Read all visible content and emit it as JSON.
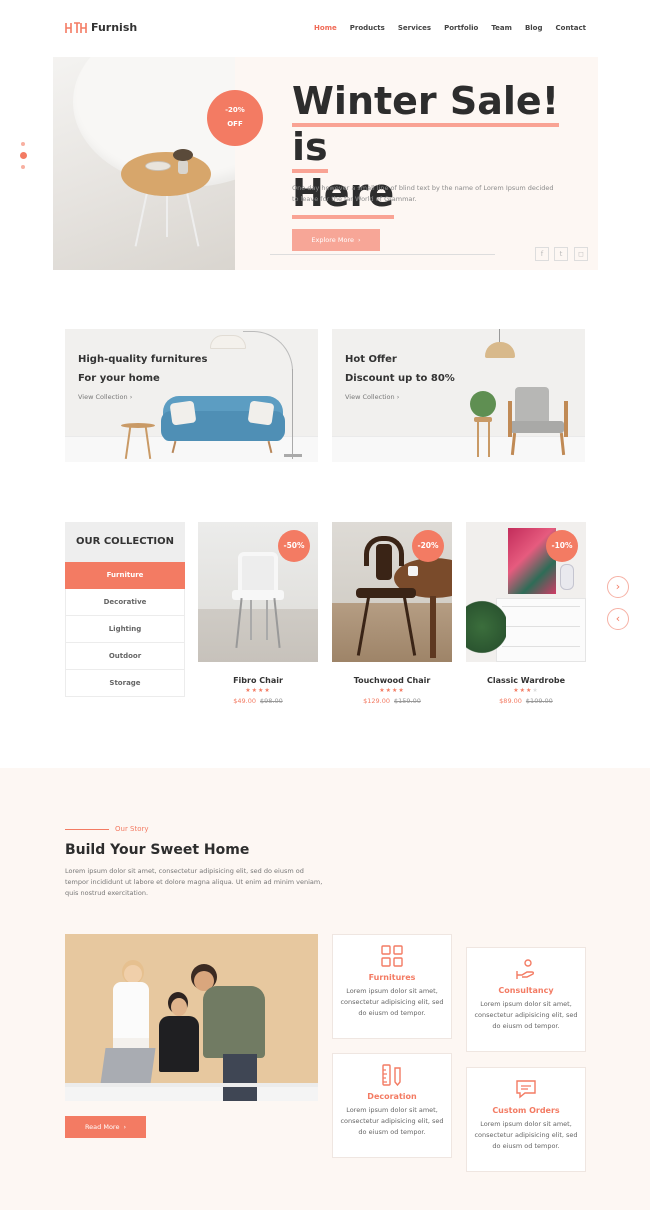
{
  "brand": {
    "logo_mark": "HTH",
    "name": "Furnish"
  },
  "nav": [
    {
      "label": "Home",
      "active": true
    },
    {
      "label": "Products"
    },
    {
      "label": "Services"
    },
    {
      "label": "Portfolio"
    },
    {
      "label": "Team"
    },
    {
      "label": "Blog"
    },
    {
      "label": "Contact"
    }
  ],
  "hero": {
    "badge_line1": "-20%",
    "badge_line2": "OFF",
    "title_line1": "Winter Sale! is",
    "title_line2": "Here",
    "description": "One day however a small line of blind text by the name of Lorem Ipsum decided to leave for the far World of Grammar.",
    "button_label": "Explore More",
    "social_icons": [
      "facebook-icon",
      "twitter-icon",
      "instagram-icon"
    ]
  },
  "promos": [
    {
      "line1": "High-quality furnitures",
      "line2": "For your home",
      "link": "View Collection"
    },
    {
      "line1": "Hot Offer",
      "line2": "Discount up to 80%",
      "link": "View Collection"
    }
  ],
  "collection": {
    "heading": "OUR COLLECTION",
    "categories": [
      {
        "label": "Furniture",
        "active": true
      },
      {
        "label": "Decorative"
      },
      {
        "label": "Lighting"
      },
      {
        "label": "Outdoor"
      },
      {
        "label": "Storage"
      }
    ],
    "products": [
      {
        "name": "Fibro Chair",
        "badge": "-50%",
        "rating": 4,
        "price": "$49.00",
        "old_price": "$98.00"
      },
      {
        "name": "Touchwood Chair",
        "badge": "-20%",
        "rating": 4,
        "price": "$129.00",
        "old_price": "$159.00"
      },
      {
        "name": "Classic Wardrobe",
        "badge": "-10%",
        "rating": 3,
        "price": "$89.00",
        "old_price": "$109.00"
      }
    ]
  },
  "story": {
    "kicker": "Our Story",
    "title": "Build Your Sweet Home",
    "description": "Lorem ipsum dolor sit amet, consectetur adipisicing elit, sed do eiusm od tempor incididunt ut labore et dolore magna aliqua. Ut enim ad minim veniam, quis nostrud exercitation.",
    "button_label": "Read More",
    "features": [
      {
        "title": "Furnitures",
        "icon": "grid-icon",
        "text": "Lorem ipsum dolor sit amet, consectetur adipisicing elit, sed do eiusm od tempor."
      },
      {
        "title": "Consultancy",
        "icon": "hand-icon",
        "text": "Lorem ipsum dolor sit amet, consectetur adipisicing elit, sed do eiusm od tempor."
      },
      {
        "title": "Decoration",
        "icon": "ruler-pencil-icon",
        "text": "Lorem ipsum dolor sit amet, consectetur adipisicing elit, sed do eiusm od tempor."
      },
      {
        "title": "Custom Orders",
        "icon": "chat-icon",
        "text": "Lorem ipsum dolor sit amet, consectetur adipisicing elit, sed do eiusm od tempor."
      }
    ]
  },
  "colors": {
    "accent": "#f37b63",
    "accent_light": "#f7a697",
    "hero_bg": "#fdf7f3"
  }
}
